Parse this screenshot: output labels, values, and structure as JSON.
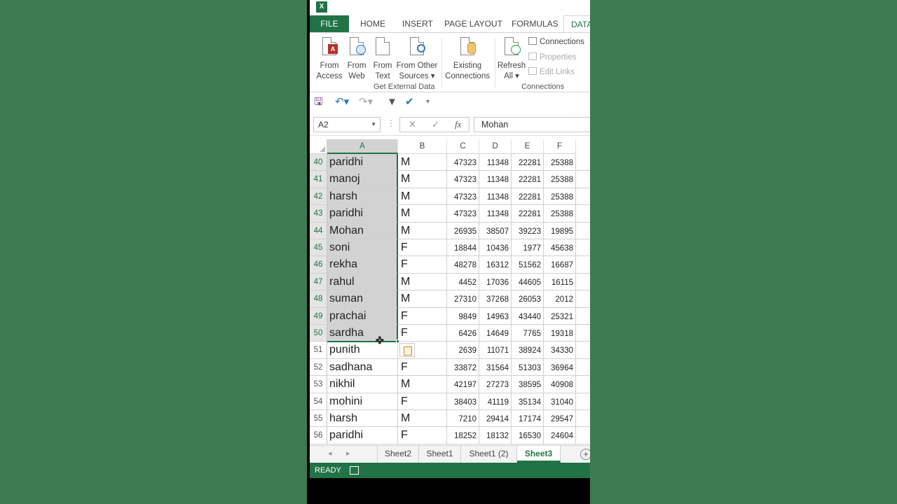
{
  "app": {
    "logo_letter": "X"
  },
  "ribbon_tabs": [
    "FILE",
    "HOME",
    "INSERT",
    "PAGE LAYOUT",
    "FORMULAS",
    "DATA"
  ],
  "ribbon": {
    "get_external": [
      {
        "line1": "From",
        "line2": "Access"
      },
      {
        "line1": "From",
        "line2": "Web"
      },
      {
        "line1": "From",
        "line2": "Text"
      },
      {
        "line1": "From Other",
        "line2": "Sources ▾"
      }
    ],
    "existing": {
      "line1": "Existing",
      "line2": "Connections"
    },
    "group_external": "Get External Data",
    "refresh": {
      "line1": "Refresh",
      "line2": "All ▾"
    },
    "connections_cmds": [
      "Connections",
      "Properties",
      "Edit Links"
    ],
    "group_connections": "Connections"
  },
  "formula_bar": {
    "name_box": "A2",
    "fx": "fx",
    "value": "Mohan"
  },
  "columns": [
    "A",
    "B",
    "C",
    "D",
    "E",
    "F"
  ],
  "rows": [
    {
      "n": "40",
      "a": "paridhi",
      "b": "M",
      "c": "47323",
      "d": "11348",
      "e": "22281",
      "f": "25388"
    },
    {
      "n": "41",
      "a": "manoj",
      "b": "M",
      "c": "47323",
      "d": "11348",
      "e": "22281",
      "f": "25388"
    },
    {
      "n": "42",
      "a": "harsh",
      "b": "M",
      "c": "47323",
      "d": "11348",
      "e": "22281",
      "f": "25388"
    },
    {
      "n": "43",
      "a": "paridhi",
      "b": "M",
      "c": "47323",
      "d": "11348",
      "e": "22281",
      "f": "25388"
    },
    {
      "n": "44",
      "a": "Mohan",
      "b": "M",
      "c": "26935",
      "d": "38507",
      "e": "39223",
      "f": "19895"
    },
    {
      "n": "45",
      "a": "soni",
      "b": "F",
      "c": "18844",
      "d": "10436",
      "e": "1977",
      "f": "45638"
    },
    {
      "n": "46",
      "a": "rekha",
      "b": "F",
      "c": "48278",
      "d": "16312",
      "e": "51562",
      "f": "16687"
    },
    {
      "n": "47",
      "a": "rahul",
      "b": "M",
      "c": "4452",
      "d": "17036",
      "e": "44605",
      "f": "16115"
    },
    {
      "n": "48",
      "a": "suman",
      "b": "M",
      "c": "27310",
      "d": "37268",
      "e": "26053",
      "f": "2012"
    },
    {
      "n": "49",
      "a": "prachai",
      "b": "F",
      "c": "9849",
      "d": "14963",
      "e": "43440",
      "f": "25321"
    },
    {
      "n": "50",
      "a": "sardha",
      "b": "F",
      "c": "6426",
      "d": "14649",
      "e": "7765",
      "f": "19318"
    },
    {
      "n": "51",
      "a": "punith",
      "b": "",
      "c": "2639",
      "d": "11071",
      "e": "38924",
      "f": "34330"
    },
    {
      "n": "52",
      "a": "sadhana",
      "b": "F",
      "c": "33872",
      "d": "31564",
      "e": "51303",
      "f": "36964"
    },
    {
      "n": "53",
      "a": "nikhil",
      "b": "M",
      "c": "42197",
      "d": "27273",
      "e": "38595",
      "f": "40908"
    },
    {
      "n": "54",
      "a": "mohini",
      "b": "F",
      "c": "38403",
      "d": "41119",
      "e": "35134",
      "f": "31040"
    },
    {
      "n": "55",
      "a": "harsh",
      "b": "M",
      "c": "7210",
      "d": "29414",
      "e": "17174",
      "f": "29547"
    },
    {
      "n": "56",
      "a": "paridhi",
      "b": "F",
      "c": "18252",
      "d": "18132",
      "e": "16530",
      "f": "24604"
    }
  ],
  "sheet_tabs": [
    "Sheet2",
    "Sheet1",
    "Sheet1 (2)",
    "Sheet3"
  ],
  "active_sheet": "Sheet3",
  "status": {
    "text": "READY"
  },
  "colors": {
    "accent": "#217346",
    "selection": "#d2d2d2"
  }
}
